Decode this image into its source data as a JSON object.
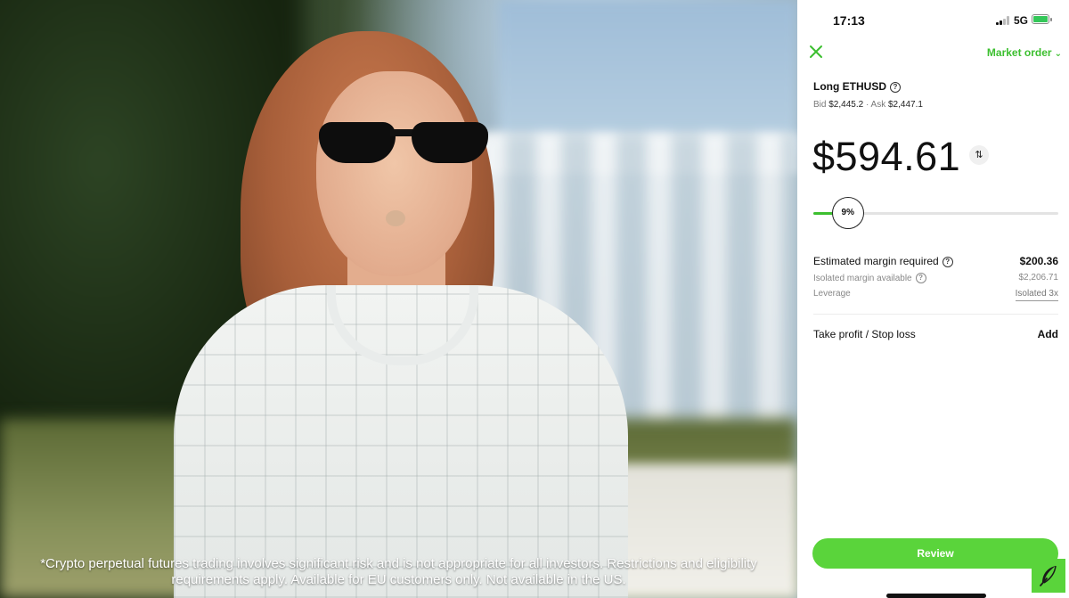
{
  "video": {
    "disclaimer_line1": "*Crypto perpetual futures trading involves significant risk and is not appropriate for all investors. Restrictions and eligibility",
    "disclaimer_line2": "requirements apply. Available for EU customers only. Not available in the US."
  },
  "status_bar": {
    "time": "17:13",
    "network": "5G"
  },
  "header": {
    "order_type": "Market order"
  },
  "instrument": {
    "title": "Long ETHUSD",
    "bid_label": "Bid",
    "bid_value": "$2,445.2",
    "separator": "·",
    "ask_label": "Ask",
    "ask_value": "$2,447.1"
  },
  "order": {
    "amount": "$594.61",
    "slider_label": "9%",
    "slider_percent": 9
  },
  "details": {
    "est_margin_label": "Estimated margin required",
    "est_margin_value": "$200.36",
    "isolated_available_label": "Isolated margin available",
    "isolated_available_value": "$2,206.71",
    "leverage_label": "Leverage",
    "leverage_value": "Isolated 3x"
  },
  "tpsl": {
    "label": "Take profit / Stop loss",
    "action": "Add"
  },
  "actions": {
    "review": "Review"
  },
  "colors": {
    "accent": "#3cbf2f",
    "button": "#5ad43b"
  }
}
